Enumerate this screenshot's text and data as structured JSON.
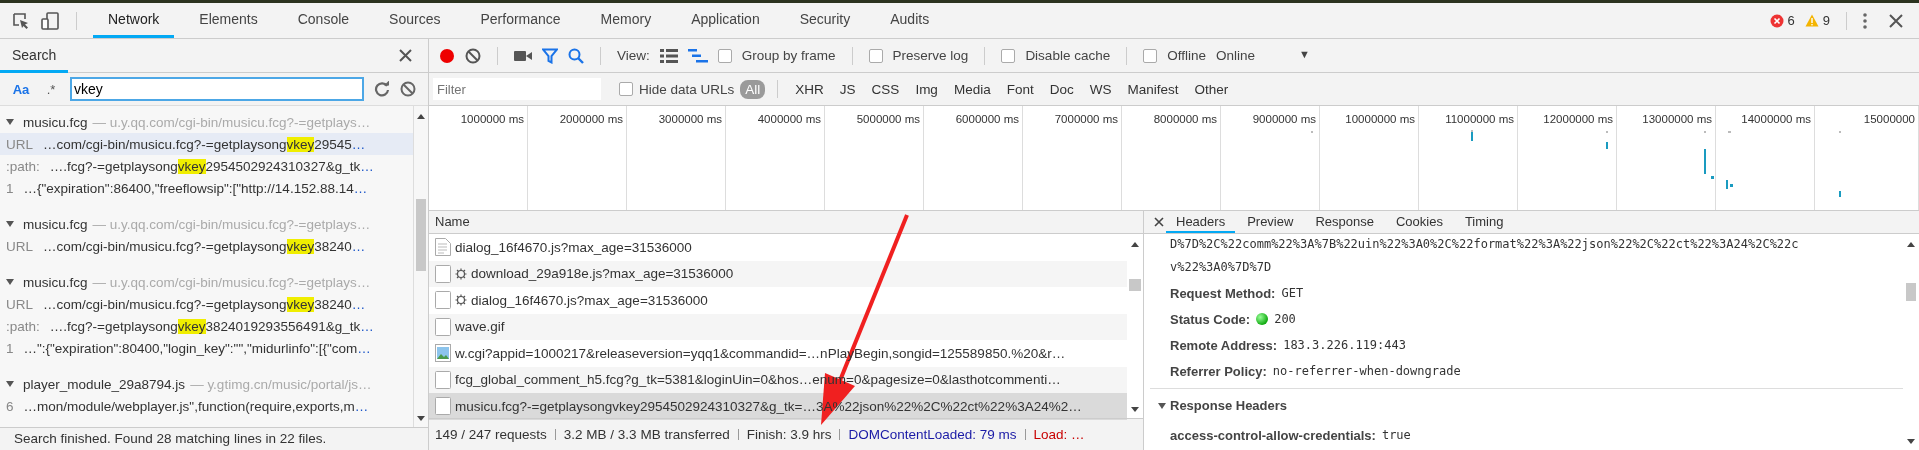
{
  "main_tabs": [
    {
      "label": "Network",
      "selected": true
    },
    {
      "label": "Elements",
      "selected": false
    },
    {
      "label": "Console",
      "selected": false
    },
    {
      "label": "Sources",
      "selected": false
    },
    {
      "label": "Performance",
      "selected": false
    },
    {
      "label": "Memory",
      "selected": false
    },
    {
      "label": "Application",
      "selected": false
    },
    {
      "label": "Security",
      "selected": false
    },
    {
      "label": "Audits",
      "selected": false
    }
  ],
  "counters": {
    "errors": "6",
    "warnings": "9"
  },
  "search": {
    "tab": "Search",
    "case_label": "Aa",
    "case_sensitive": true,
    "regex_label": ".*",
    "query": "vkey",
    "groups": [
      {
        "file": "musicu.fcg",
        "url": "— u.y.qq.com/cgi-bin/musicu.fcg?-=getplays…",
        "expanded": true,
        "lines": [
          {
            "label": "URL",
            "before": "…com/cgi-bin/musicu.fcg?-=getplaysong",
            "match": "vkey",
            "after": "29545",
            "more": "…",
            "selected": true
          },
          {
            "label": ":path:",
            "before": "….fcg?-=getplaysong",
            "match": "vkey",
            "after": "2954502924310327&g_tk",
            "more": "…",
            "selected": false
          },
          {
            "label": "1",
            "before": "…{\"expiration\":86400,\"freeflowsip\":[\"http://14.152.88.14",
            "more": "…",
            "selected": false
          }
        ]
      },
      {
        "file": "musicu.fcg",
        "url": "— u.y.qq.com/cgi-bin/musicu.fcg?-=getplays…",
        "expanded": true,
        "lines": [
          {
            "label": "URL",
            "before": "…com/cgi-bin/musicu.fcg?-=getplaysong",
            "match": "vkey",
            "after": "38240",
            "more": "…",
            "selected": false
          }
        ]
      },
      {
        "file": "musicu.fcg",
        "url": "— u.y.qq.com/cgi-bin/musicu.fcg?-=getplays…",
        "expanded": true,
        "lines": [
          {
            "label": "URL",
            "before": "…com/cgi-bin/musicu.fcg?-=getplaysong",
            "match": "vkey",
            "after": "38240",
            "more": "…",
            "selected": false
          },
          {
            "label": ":path:",
            "before": "….fcg?-=getplaysong",
            "match": "vkey",
            "after": "3824019293556491&g_tk",
            "more": "…",
            "selected": false
          },
          {
            "label": "1",
            "before": "…\":{\"expiration\":80400,\"login_key\":\"\",\"midurlinfo\":[{\"com",
            "more": "…",
            "selected": false
          }
        ]
      },
      {
        "file": "player_module_29a8794.js",
        "url": "— y.gtimg.cn/music/portal/js…",
        "expanded": true,
        "lines": [
          {
            "label": "6",
            "before": "…mon/module/webplayer.js\",function(require,exports,m",
            "more": "…",
            "selected": false
          }
        ]
      }
    ],
    "status": "Search finished.  Found 28 matching lines in 22 files."
  },
  "toolbar": {
    "recording": true,
    "filter_active": true,
    "view_label": "View:",
    "large_rows": false,
    "checkboxes": [
      {
        "label": "Group by frame",
        "checked": false
      },
      {
        "label": "Preserve log",
        "checked": false
      },
      {
        "label": "Disable cache",
        "checked": false
      },
      {
        "label": "Offline",
        "checked": false
      }
    ],
    "throttling": "Online",
    "throttling_caret": "▼"
  },
  "filter_bar": {
    "placeholder": "Filter",
    "hide_data_urls": {
      "label": "Hide data URLs",
      "checked": false
    },
    "types": [
      {
        "label": "All",
        "selected": true
      },
      {
        "label": "XHR",
        "selected": false
      },
      {
        "label": "JS",
        "selected": false
      },
      {
        "label": "CSS",
        "selected": false
      },
      {
        "label": "Img",
        "selected": false
      },
      {
        "label": "Media",
        "selected": false
      },
      {
        "label": "Font",
        "selected": false
      },
      {
        "label": "Doc",
        "selected": false
      },
      {
        "label": "WS",
        "selected": false
      },
      {
        "label": "Manifest",
        "selected": false
      },
      {
        "label": "Other",
        "selected": false
      }
    ]
  },
  "overview_ticks": [
    "1000000 ms",
    "2000000 ms",
    "3000000 ms",
    "4000000 ms",
    "5000000 ms",
    "6000000 ms",
    "7000000 ms",
    "8000000 ms",
    "9000000 ms",
    "10000000 ms",
    "11000000 ms",
    "12000000 ms",
    "13000000 ms",
    "14000000 ms",
    "15000000"
  ],
  "requests": {
    "column": "Name",
    "rows": [
      {
        "kind": "script",
        "name": "dialog_16f4670.js?max_age=31536000",
        "selected": false
      },
      {
        "kind": "cached",
        "name": "download_29a918e.js?max_age=31536000",
        "selected": false
      },
      {
        "kind": "cached",
        "name": "dialog_16f4670.js?max_age=31536000",
        "selected": false
      },
      {
        "kind": "blank",
        "name": "wave.gif",
        "selected": false
      },
      {
        "kind": "image",
        "name": "w.cgi?appid=1000217&releaseversion=yqq1&commandid=…nPlayBegin,songid=125589850.%20&r…",
        "selected": false
      },
      {
        "kind": "blank",
        "name": "fcg_global_comment_h5.fcg?g_tk=5381&loginUin=0&hos…enum=0&pagesize=0&lasthotcommenti…",
        "selected": false
      },
      {
        "kind": "blank",
        "name": "musicu.fcg?-=getplaysongvkey2954502924310327&g_tk=…3A%22json%22%2C%22ct%22%3A24%2…",
        "selected": true
      }
    ]
  },
  "summary": [
    {
      "kind": "plain",
      "text": "149 / 247 requests"
    },
    {
      "kind": "plain",
      "text": "3.2 MB / 3.3 MB transferred"
    },
    {
      "kind": "plain",
      "text": "Finish: 3.9 hrs"
    },
    {
      "kind": "dom",
      "text": "DOMContentLoaded: 79 ms"
    },
    {
      "kind": "load",
      "text": "Load: …"
    }
  ],
  "details": {
    "tabs": [
      {
        "label": "Headers",
        "selected": true
      },
      {
        "label": "Preview",
        "selected": false
      },
      {
        "label": "Response",
        "selected": false
      },
      {
        "label": "Cookies",
        "selected": false
      },
      {
        "label": "Timing",
        "selected": false
      }
    ],
    "url_tail": [
      "D%7D%2C%22comm%22%3A%7B%22uin%22%3A0%2C%22format%22%3A%22json%22%2C%22ct%22%3A24%2C%22c",
      "v%22%3A0%7D%7D"
    ],
    "general": [
      {
        "key": "Request Method:",
        "value": "GET",
        "status_ok": false
      },
      {
        "key": "Status Code:",
        "value": "200",
        "status_ok": true
      },
      {
        "key": "Remote Address:",
        "value": "183.3.226.119:443",
        "status_ok": false
      },
      {
        "key": "Referrer Policy:",
        "value": "no-referrer-when-downgrade",
        "status_ok": false
      }
    ],
    "section": {
      "title": "Response Headers",
      "expanded": true
    },
    "response_headers": [
      {
        "key": "access-control-allow-credentials:",
        "value": "true"
      }
    ]
  }
}
